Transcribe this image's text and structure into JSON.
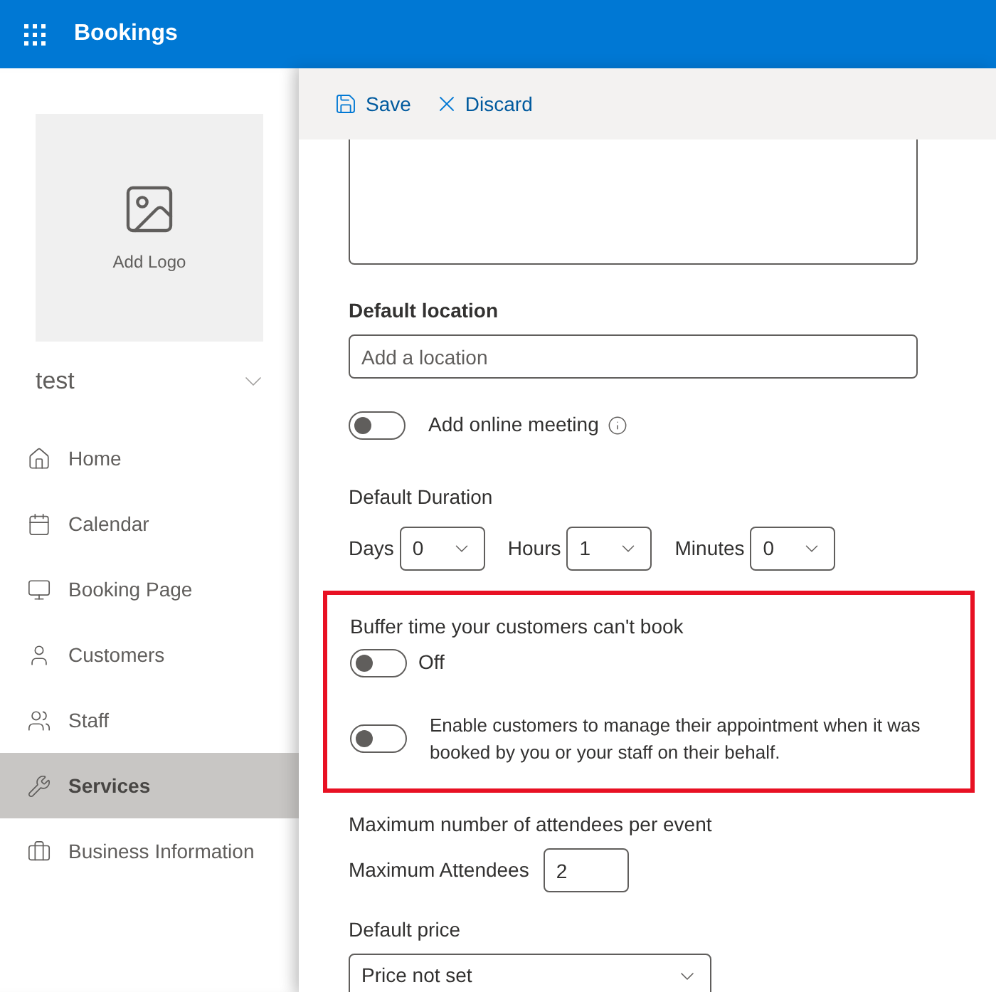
{
  "header": {
    "title": "Bookings"
  },
  "sidebar": {
    "logo_label": "Add Logo",
    "business": "test",
    "items": [
      {
        "label": "Home",
        "kind": "home",
        "selected": false
      },
      {
        "label": "Calendar",
        "kind": "calendar",
        "selected": false
      },
      {
        "label": "Booking Page",
        "kind": "page",
        "selected": false
      },
      {
        "label": "Customers",
        "kind": "customers",
        "selected": false
      },
      {
        "label": "Staff",
        "kind": "staff",
        "selected": false
      },
      {
        "label": "Services",
        "kind": "services",
        "selected": true
      },
      {
        "label": "Business Information",
        "kind": "business",
        "selected": false
      }
    ]
  },
  "toolbar": {
    "save": "Save",
    "discard": "Discard"
  },
  "form": {
    "location": {
      "label": "Default location",
      "placeholder": "Add a location"
    },
    "online_meeting": {
      "label": "Add online meeting",
      "on": false
    },
    "duration": {
      "label": "Default Duration",
      "fields": [
        {
          "label": "Days",
          "value": "0"
        },
        {
          "label": "Hours",
          "value": "1"
        },
        {
          "label": "Minutes",
          "value": "0"
        }
      ]
    },
    "highlight": {
      "shown": true,
      "buffer": {
        "label": "Buffer time your customers can't book",
        "on": false,
        "state_text": "Off"
      },
      "manage": {
        "label": "Enable customers to manage their appointment when it was booked by you or your staff on their behalf.",
        "on": false
      }
    },
    "attendees": {
      "heading": "Maximum number of attendees per event",
      "label": "Maximum Attendees",
      "value": "2"
    },
    "price": {
      "label": "Default price",
      "value": "Price not set"
    }
  }
}
